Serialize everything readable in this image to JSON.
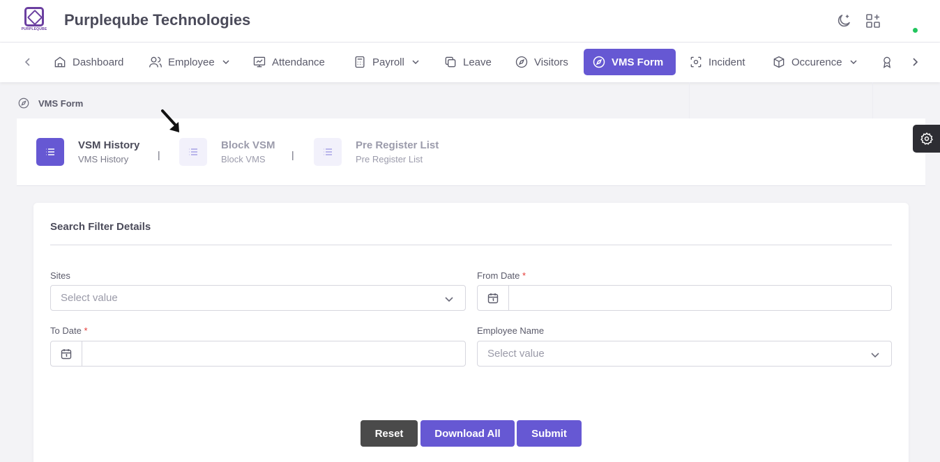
{
  "app": {
    "logo_text": "PURPLEQUBE",
    "brand": "Purpleqube Technologies"
  },
  "header": {
    "icons": [
      "moon-icon",
      "apps-grid-icon"
    ],
    "online_status_color": "#22c55e"
  },
  "nav": {
    "items": [
      {
        "label": "Dashboard",
        "icon": "home-icon"
      },
      {
        "label": "Employee",
        "icon": "users-icon",
        "dropdown": true
      },
      {
        "label": "Attendance",
        "icon": "presentation-icon"
      },
      {
        "label": "Payroll",
        "icon": "calculator-icon",
        "dropdown": true
      },
      {
        "label": "Leave",
        "icon": "copy-icon"
      },
      {
        "label": "Visitors",
        "icon": "compass-icon"
      },
      {
        "label": "VMS Form",
        "icon": "compass-icon",
        "active": true
      },
      {
        "label": "Incident",
        "icon": "focus-icon"
      },
      {
        "label": "Occurence",
        "icon": "boxes-icon",
        "dropdown": true
      }
    ],
    "accent": "#6658d3"
  },
  "breadcrumb": {
    "label": "VMS Form"
  },
  "tabs": [
    {
      "title": "VSM History",
      "subtitle": "VMS History",
      "active": true
    },
    {
      "title": "Block VSM",
      "subtitle": "Block VMS",
      "active": false
    },
    {
      "title": "Pre Register List",
      "subtitle": "Pre Register List",
      "active": false
    }
  ],
  "tab_separator": "|",
  "filter": {
    "title": "Search Filter Details",
    "sites": {
      "label": "Sites",
      "placeholder": "Select value"
    },
    "from_date": {
      "label": "From Date",
      "required_mark": "*",
      "value": ""
    },
    "to_date": {
      "label": "To Date",
      "required_mark": "*",
      "value": ""
    },
    "employee_name": {
      "label": "Employee Name",
      "placeholder": "Select value"
    }
  },
  "buttons": {
    "reset": "Reset",
    "download_all": "Download All",
    "submit": "Submit"
  }
}
